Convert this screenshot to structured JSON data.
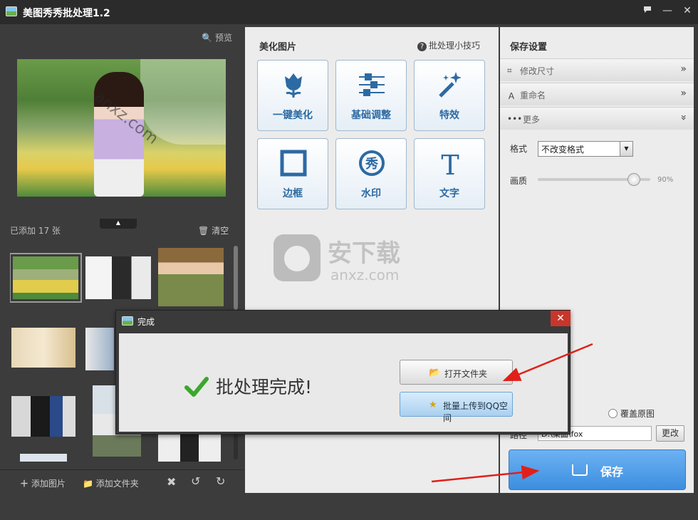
{
  "window": {
    "title": "美图秀秀批处理1.2"
  },
  "left_panel": {
    "preview_label": "预览",
    "photo_watermark": "anxz.com",
    "added_label": "已添加 17 张",
    "clear_label": "清空",
    "add_image_label": "添加图片",
    "add_folder_label": "添加文件夹"
  },
  "middle_panel": {
    "title": "美化图片",
    "tips_label": "批处理小技巧",
    "tools": [
      {
        "label": "一键美化",
        "icon": "tulip-icon"
      },
      {
        "label": "基础调整",
        "icon": "sliders-icon"
      },
      {
        "label": "特效",
        "icon": "magic-wand-icon"
      },
      {
        "label": "边框",
        "icon": "frame-icon"
      },
      {
        "label": "水印",
        "icon": "watermark-stamp-icon"
      },
      {
        "label": "文字",
        "icon": "text-t-icon"
      }
    ],
    "watermark_text": "安下载",
    "watermark_sub": "anxz.com"
  },
  "right_panel": {
    "title": "保存设置",
    "sections": [
      {
        "label": "修改尺寸",
        "icon": "crop-icon",
        "state": "collapsed"
      },
      {
        "label": "重命名",
        "icon": "rename-icon",
        "state": "collapsed"
      },
      {
        "label": "更多",
        "icon": "more-dots-icon",
        "state": "expanded"
      }
    ],
    "format_label": "格式",
    "format_value": "不改变格式",
    "quality_label": "画质",
    "quality_value": "90%",
    "quality_level": 0.9,
    "overwrite_label": "覆盖原图",
    "path_label": "路径",
    "path_value": "D:\\桌面\\fox",
    "change_label": "更改",
    "save_label": "保存"
  },
  "dialog": {
    "title": "完成",
    "message": "批处理完成!",
    "open_folder_label": "打开文件夹",
    "upload_label": "批量上传到QQ空间"
  },
  "colors": {
    "accent_blue": "#3c8ee0",
    "tool_label_blue": "#2c6aa3",
    "close_red": "#c8352b",
    "check_green": "#3aa82c",
    "annotation_red": "#e0201a"
  }
}
